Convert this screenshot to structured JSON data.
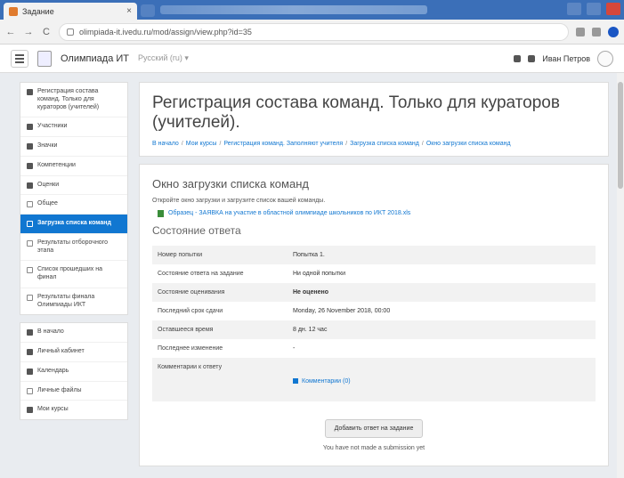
{
  "browser": {
    "tab_title": "Задание",
    "close_glyph": "×",
    "url": "olimpiada-it.ivedu.ru/mod/assign/view.php?id=35",
    "back_glyph": "←",
    "forward_glyph": "→",
    "reload_glyph": "C"
  },
  "site": {
    "name": "Олимпиада ИТ",
    "language": "Русский (ru) ▾",
    "user_name": "Иван Петров"
  },
  "sidebar": {
    "top": [
      {
        "label": "Регистрация состава команд. Только для кураторов (учителей)"
      },
      {
        "label": "Участники"
      },
      {
        "label": "Значки"
      },
      {
        "label": "Компетенции"
      },
      {
        "label": "Оценки"
      },
      {
        "label": "Общее"
      },
      {
        "label": "Загрузка списка команд"
      },
      {
        "label": "Результаты отборочного этапа"
      },
      {
        "label": "Список прошедших на финал"
      },
      {
        "label": "Результаты финала Олимпиады ИКТ"
      }
    ],
    "bottom": [
      {
        "label": "В начало"
      },
      {
        "label": "Личный кабинет"
      },
      {
        "label": "Календарь"
      },
      {
        "label": "Личные файлы"
      },
      {
        "label": "Мои курсы"
      }
    ]
  },
  "page": {
    "title": "Регистрация состава команд. Только для кураторов (учителей).",
    "breadcrumb": [
      "В начало",
      "Мои курсы",
      "Регистрация команд. Заполняют учителя",
      "Загрузка списка команд",
      "Окно загрузки списка команд"
    ],
    "section_title": "Окно загрузки списка команд",
    "description": "Откройте окно загрузки и загрузите список вашей команды.",
    "file_link": "Образец - ЗАЯВКА на участие в областной олимпиаде школьников по ИКТ 2018.xls",
    "status_title": "Состояние ответа"
  },
  "status_table": [
    {
      "key": "Номер попытки",
      "value": "Попытка 1."
    },
    {
      "key": "Состояние ответа на задание",
      "value": "Ни одной попытки"
    },
    {
      "key": "Состояние оценивания",
      "value": "Не оценено"
    },
    {
      "key": "Последний срок сдачи",
      "value": "Monday, 26 November 2018, 00:00"
    },
    {
      "key": "Оставшееся время",
      "value": "8 дн. 12 час"
    },
    {
      "key": "Последнее изменение",
      "value": "-"
    },
    {
      "key": "Комментарии к ответу",
      "value": "Комментарии (0)"
    }
  ],
  "actions": {
    "submit_label": "Добавить ответ на задание",
    "note": "You have not made a submission yet"
  }
}
